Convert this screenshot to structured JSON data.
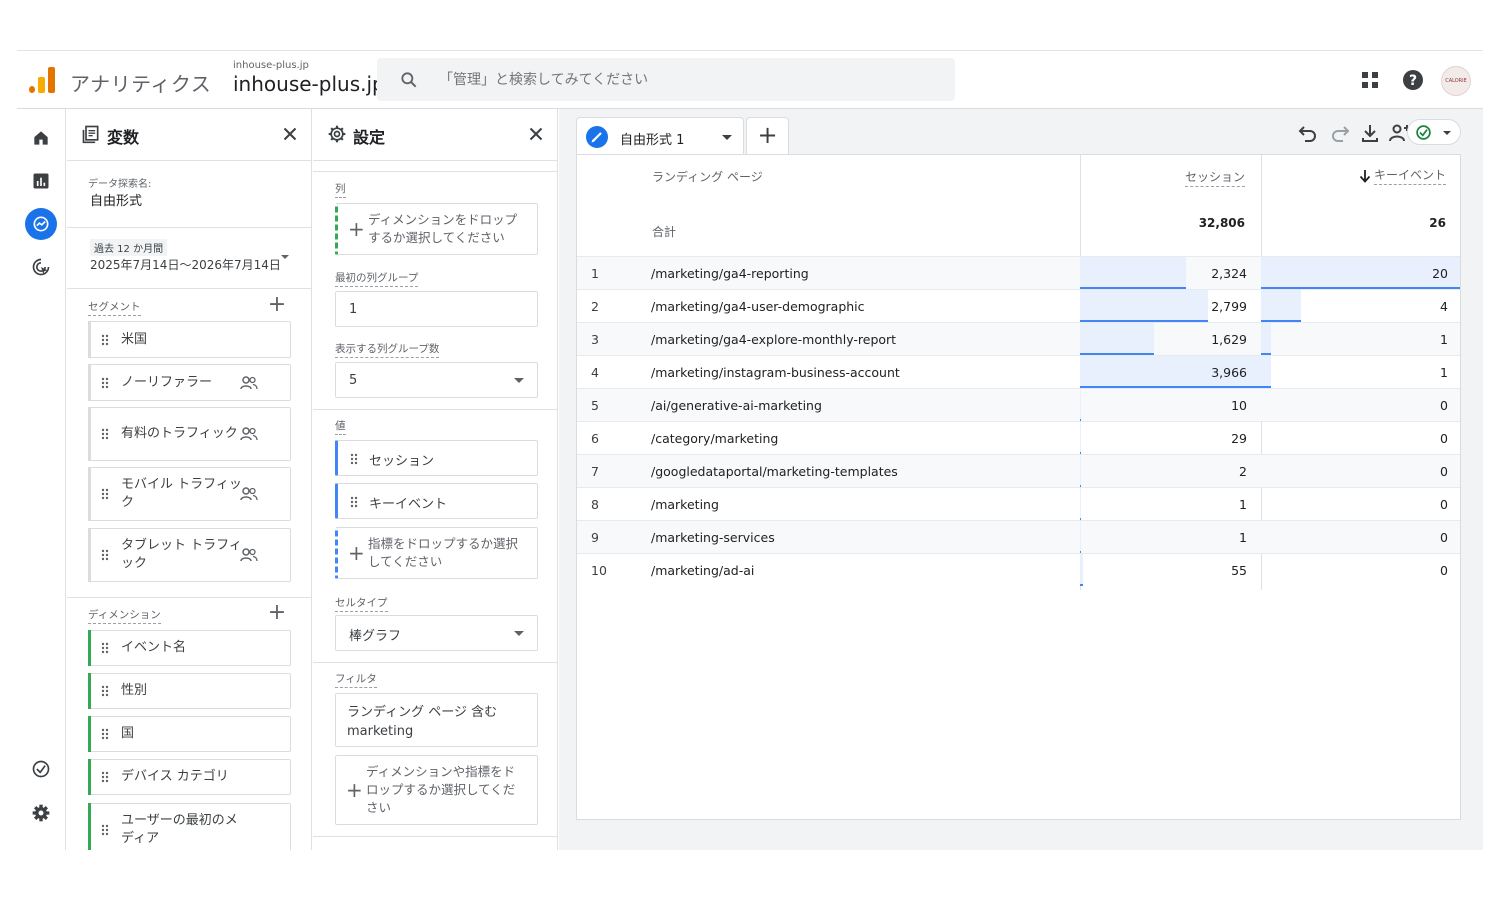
{
  "header": {
    "app_name": "アナリティクス",
    "account_small": "inhouse-plus.jp",
    "account_big": "inhouse-plus.jp",
    "search_placeholder": "「管理」と検索してみてください",
    "avatar_text": "CALORIE"
  },
  "variables": {
    "title": "変数",
    "exploration_label": "データ探索名:",
    "exploration_name": "自由形式",
    "date_badge": "過去 12 か月間",
    "date_range": "2025年7月14日〜2026年7月14日",
    "segments_label": "セグメント",
    "segments": [
      {
        "label": "米国",
        "people": false
      },
      {
        "label": "ノーリファラー",
        "people": true
      },
      {
        "label": "有料のトラフィック",
        "people": true
      },
      {
        "label": "モバイル トラフィック",
        "people": true
      },
      {
        "label": "タブレット トラフィック",
        "people": true
      }
    ],
    "dimensions_label": "ディメンション",
    "dimensions": [
      {
        "label": "イベント名"
      },
      {
        "label": "性別"
      },
      {
        "label": "国"
      },
      {
        "label": "デバイス カテゴリ"
      },
      {
        "label": "ユーザーの最初のメディア"
      }
    ]
  },
  "settings": {
    "title": "設定",
    "columns_label": "列",
    "columns_drop": "ディメンションをドロップするか選択してください",
    "first_col_group_label": "最初の列グループ",
    "first_col_group_value": "1",
    "show_col_groups_label": "表示する列グループ数",
    "show_col_groups_value": "5",
    "values_label": "値",
    "values": [
      "セッション",
      "キーイベント"
    ],
    "values_drop": "指標をドロップするか選択してください",
    "cell_type_label": "セルタイプ",
    "cell_type_value": "棒グラフ",
    "filter_label": "フィルタ",
    "filter_value": "ランディング ページ 含む marketing",
    "filter_drop": "ディメンションや指標をドロップするか選択してください"
  },
  "canvas": {
    "tab_label": "自由形式 1",
    "table": {
      "dim_header": "ランディング ページ",
      "metric1_header": "セッション",
      "metric2_header": "キーイベント",
      "totals_label": "合計",
      "total1": "32,806",
      "total2": "26",
      "max1": 3966,
      "max2": 20,
      "rows": [
        {
          "idx": "1",
          "page": "/marketing/ga4-reporting",
          "m1": "2,324",
          "m2": "20",
          "v1": 2324,
          "v2": 20
        },
        {
          "idx": "2",
          "page": "/marketing/ga4-user-demographic",
          "m1": "2,799",
          "m2": "4",
          "v1": 2799,
          "v2": 4
        },
        {
          "idx": "3",
          "page": "/marketing/ga4-explore-monthly-report",
          "m1": "1,629",
          "m2": "1",
          "v1": 1629,
          "v2": 1
        },
        {
          "idx": "4",
          "page": "/marketing/instagram-business-account",
          "m1": "3,966",
          "m2": "1",
          "v1": 3966,
          "v2": 1
        },
        {
          "idx": "5",
          "page": "/ai/generative-ai-marketing",
          "m1": "10",
          "m2": "0",
          "v1": 10,
          "v2": 0
        },
        {
          "idx": "6",
          "page": "/category/marketing",
          "m1": "29",
          "m2": "0",
          "v1": 29,
          "v2": 0
        },
        {
          "idx": "7",
          "page": "/googledataportal/marketing-templates",
          "m1": "2",
          "m2": "0",
          "v1": 2,
          "v2": 0
        },
        {
          "idx": "8",
          "page": "/marketing",
          "m1": "1",
          "m2": "0",
          "v1": 1,
          "v2": 0
        },
        {
          "idx": "9",
          "page": "/marketing-services",
          "m1": "1",
          "m2": "0",
          "v1": 1,
          "v2": 0
        },
        {
          "idx": "10",
          "page": "/marketing/ad-ai",
          "m1": "55",
          "m2": "0",
          "v1": 55,
          "v2": 0
        }
      ]
    }
  },
  "colors": {
    "accent": "#1a73e8",
    "bar_fill": "#e8f0fe",
    "bar_line": "#4285f4",
    "dim_green": "#34a853"
  }
}
